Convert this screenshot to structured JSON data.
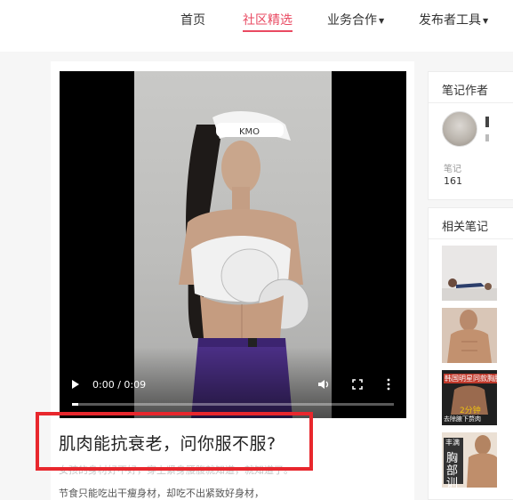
{
  "nav": {
    "items": [
      {
        "label": "首页",
        "active": false,
        "dropdown": false
      },
      {
        "label": "社区精选",
        "active": true,
        "dropdown": false
      },
      {
        "label": "业务合作",
        "active": false,
        "dropdown": true
      },
      {
        "label": "发布者工具",
        "active": false,
        "dropdown": true
      }
    ],
    "accent_color": "#e94a62"
  },
  "video": {
    "time": "0:00 / 0:09",
    "progress": 0.0,
    "visor_text": "KMO"
  },
  "note": {
    "title": "肌肉能抗衰老，问你服不服?",
    "desc_line1": "女孩的身材好不好，穿上紧身腰腹就知道，就知道了。",
    "desc_line2": "节食只能吃出干瘦身材，却吃不出紧致好身材，"
  },
  "author_card": {
    "title": "笔记作者",
    "stat_label": "笔记",
    "stat_value": "161"
  },
  "related_card": {
    "title": "相关笔记",
    "thumbs": [
      {
        "icon": "workout-thumbnail"
      },
      {
        "icon": "male-torso-thumbnail"
      },
      {
        "icon": "chest-training-thumbnail",
        "line1": "韩国明星同款胸肌",
        "line2": "2分钟",
        "line3": "去除腋下赘肉"
      },
      {
        "icon": "chest-training-thumbnail-2",
        "line1": "丰满",
        "line2": "胸",
        "line3": "部",
        "line4": "训"
      }
    ]
  },
  "highlight_color": "#e8272d"
}
